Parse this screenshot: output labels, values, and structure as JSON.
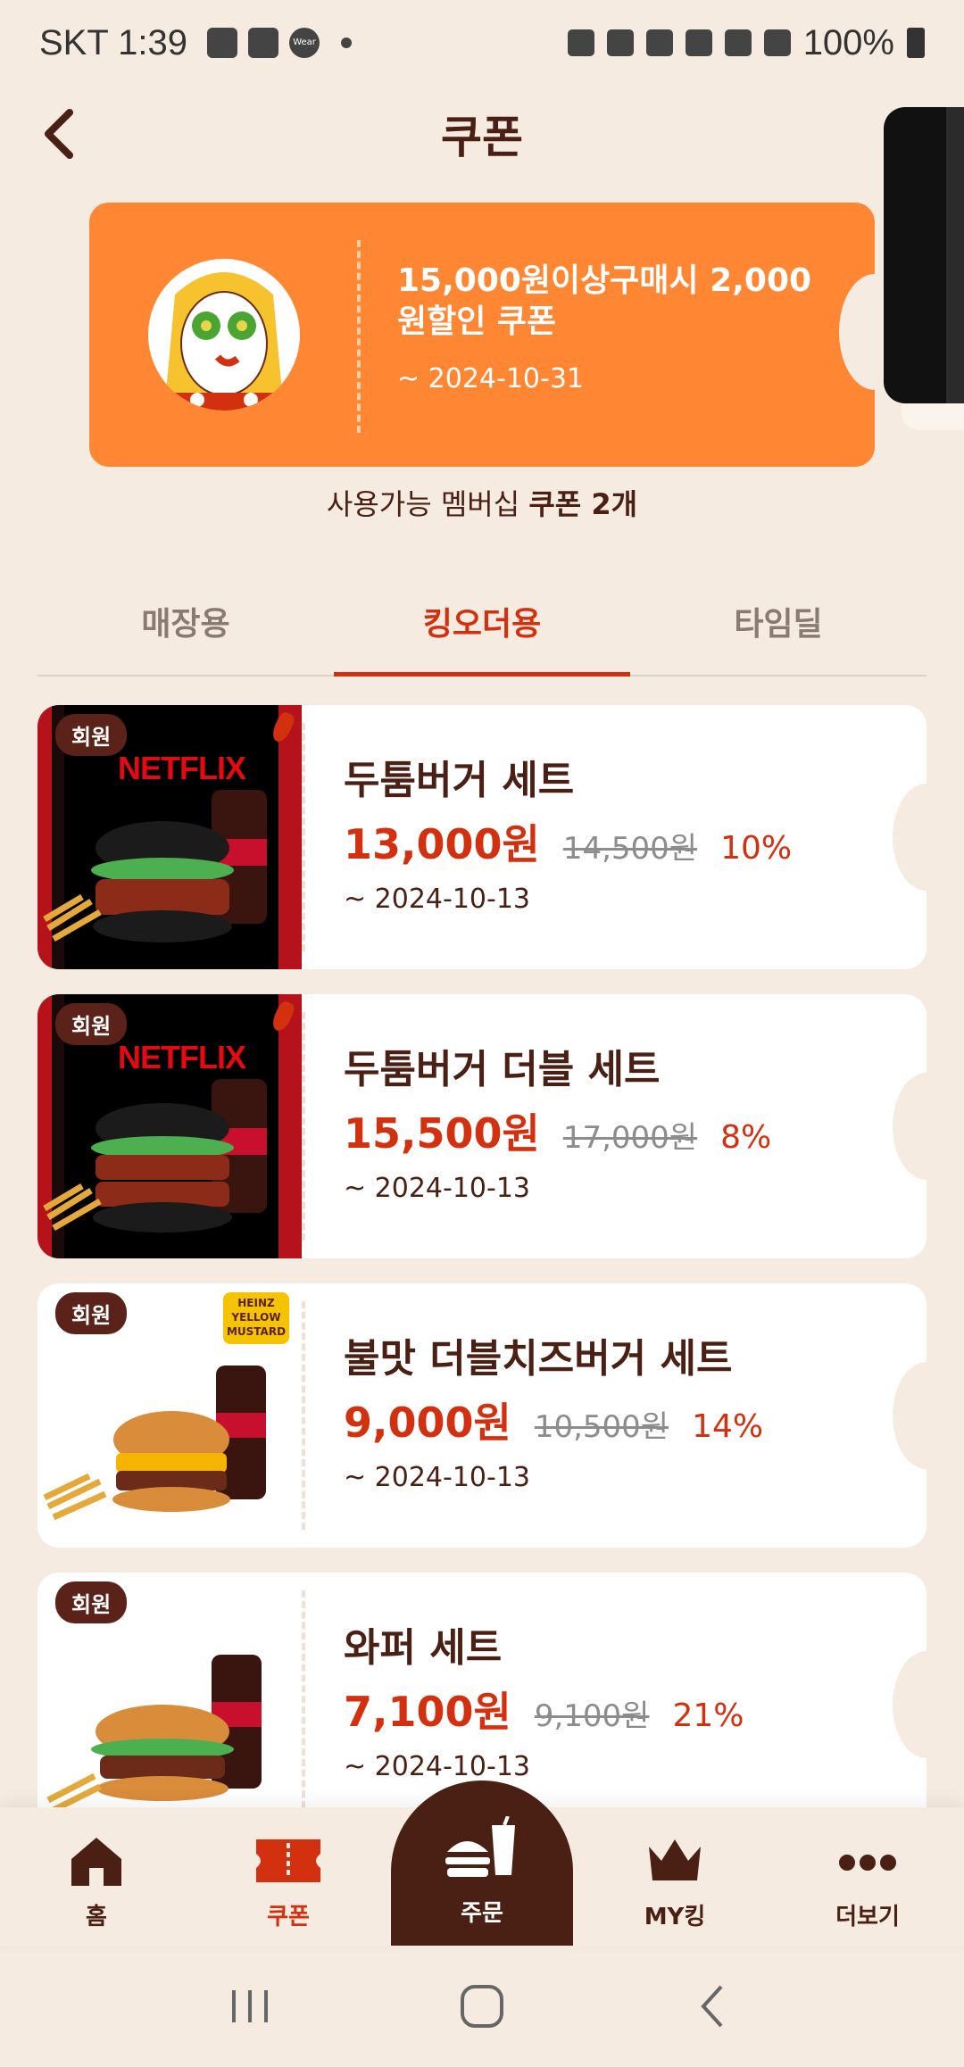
{
  "status_bar": {
    "time": "SKT 1:39",
    "battery": "100%",
    "icons": [
      "image-icon",
      "mail-icon",
      "wear-icon",
      "dot-icon",
      "lock-icon",
      "alarm-icon",
      "bluetooth-icon",
      "mute-icon",
      "wifi-icon",
      "signal-icon",
      "battery-icon"
    ],
    "wear_label": "Wear"
  },
  "header": {
    "title": "쿠폰",
    "back_icon": "chevron-left-icon"
  },
  "banner": {
    "title": "15,000원이상구매시 2,000원할인 쿠폰",
    "date": "~ 2024-10-31",
    "bg_color": "#ff8734"
  },
  "coupon_count": {
    "prefix": "사용가능 멤버십 ",
    "count": "쿠폰 2개"
  },
  "tabs": [
    {
      "label": "매장용",
      "active": false
    },
    {
      "label": "킹오더용",
      "active": true
    },
    {
      "label": "타임딜",
      "active": false
    }
  ],
  "coupons": [
    {
      "badge": "회원",
      "name": "두툼버거 세트",
      "price": "13,000원",
      "original": "14,500원",
      "discount": "10%",
      "date": "~ 2024-10-13",
      "brand": "NETFLIX"
    },
    {
      "badge": "회원",
      "name": "두툼버거 더블 세트",
      "price": "15,500원",
      "original": "17,000원",
      "discount": "8%",
      "date": "~ 2024-10-13",
      "brand": "NETFLIX"
    },
    {
      "badge": "회원",
      "name": "불맛 더블치즈버거 세트",
      "price": "9,000원",
      "original": "10,500원",
      "discount": "14%",
      "date": "~ 2024-10-13",
      "brand": "HEINZ YELLOW MUSTARD"
    },
    {
      "badge": "회원",
      "name": "와퍼 세트",
      "price": "7,100원",
      "original": "9,100원",
      "discount": "21%",
      "date": "~ 2024-10-13"
    }
  ],
  "bottom_nav": {
    "home": "홈",
    "coupon": "쿠폰",
    "order": "주문",
    "myking": "MY킹",
    "more": "더보기"
  },
  "colors": {
    "accent": "#d3300f",
    "brown": "#4a1f14",
    "background": "#f5ebe0"
  }
}
